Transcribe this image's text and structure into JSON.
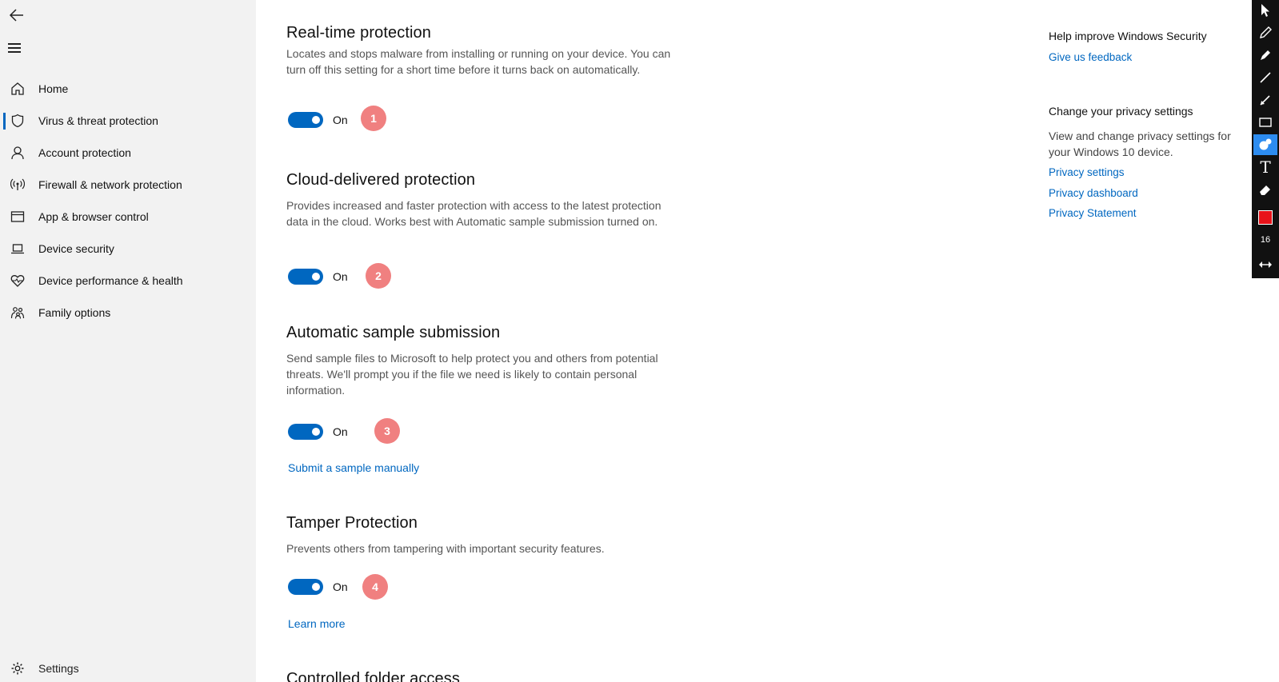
{
  "sidebar": {
    "nav": [
      {
        "label": "Home",
        "icon": "home-icon"
      },
      {
        "label": "Virus & threat protection",
        "icon": "shield-icon"
      },
      {
        "label": "Account protection",
        "icon": "person-icon"
      },
      {
        "label": "Firewall & network protection",
        "icon": "wireless-icon"
      },
      {
        "label": "App & browser control",
        "icon": "browser-window-icon"
      },
      {
        "label": "Device security",
        "icon": "laptop-icon"
      },
      {
        "label": "Device performance & health",
        "icon": "heart-pulse-icon"
      },
      {
        "label": "Family options",
        "icon": "family-icon"
      }
    ],
    "settings_label": "Settings"
  },
  "sections": [
    {
      "title": "Real-time protection",
      "description": "Locates and stops malware from installing or running on your device. You can turn off this setting for a short time before it turns back on automatically.",
      "toggle_state": "On",
      "annotation": "1"
    },
    {
      "title": "Cloud-delivered protection",
      "description": "Provides increased and faster protection with access to the latest protection data in the cloud. Works best with Automatic sample submission turned on.",
      "toggle_state": "On",
      "annotation": "2"
    },
    {
      "title": "Automatic sample submission",
      "description": "Send sample files to Microsoft to help protect you and others from potential threats. We'll prompt you if the file we need is likely to contain personal information.",
      "toggle_state": "On",
      "annotation": "3",
      "link": "Submit a sample manually"
    },
    {
      "title": "Tamper Protection",
      "description": "Prevents others from tampering with important security features.",
      "toggle_state": "On",
      "annotation": "4",
      "link": "Learn more"
    },
    {
      "title": "Controlled folder access"
    }
  ],
  "right_panel": {
    "feedback_heading": "Help improve Windows Security",
    "feedback_link": "Give us feedback",
    "privacy_heading": "Change your privacy settings",
    "privacy_text": "View and change privacy settings for your Windows 10 device.",
    "privacy_links": [
      "Privacy settings",
      "Privacy dashboard",
      "Privacy Statement"
    ]
  },
  "annotation_toolbar": {
    "tools": [
      "pointer-icon",
      "pencil-icon",
      "highlighter-icon",
      "line-icon",
      "arrow-icon",
      "rectangle-icon",
      "step-marker-icon",
      "text-icon",
      "eraser-icon"
    ],
    "text_tool_glyph": "T",
    "selected_tool": "step-marker-icon",
    "color": "#e8131a",
    "size": "16"
  },
  "colors": {
    "accent": "#0067c0",
    "annotation_badge": "#f08080",
    "sidebar_bg": "#f2f2f2"
  }
}
